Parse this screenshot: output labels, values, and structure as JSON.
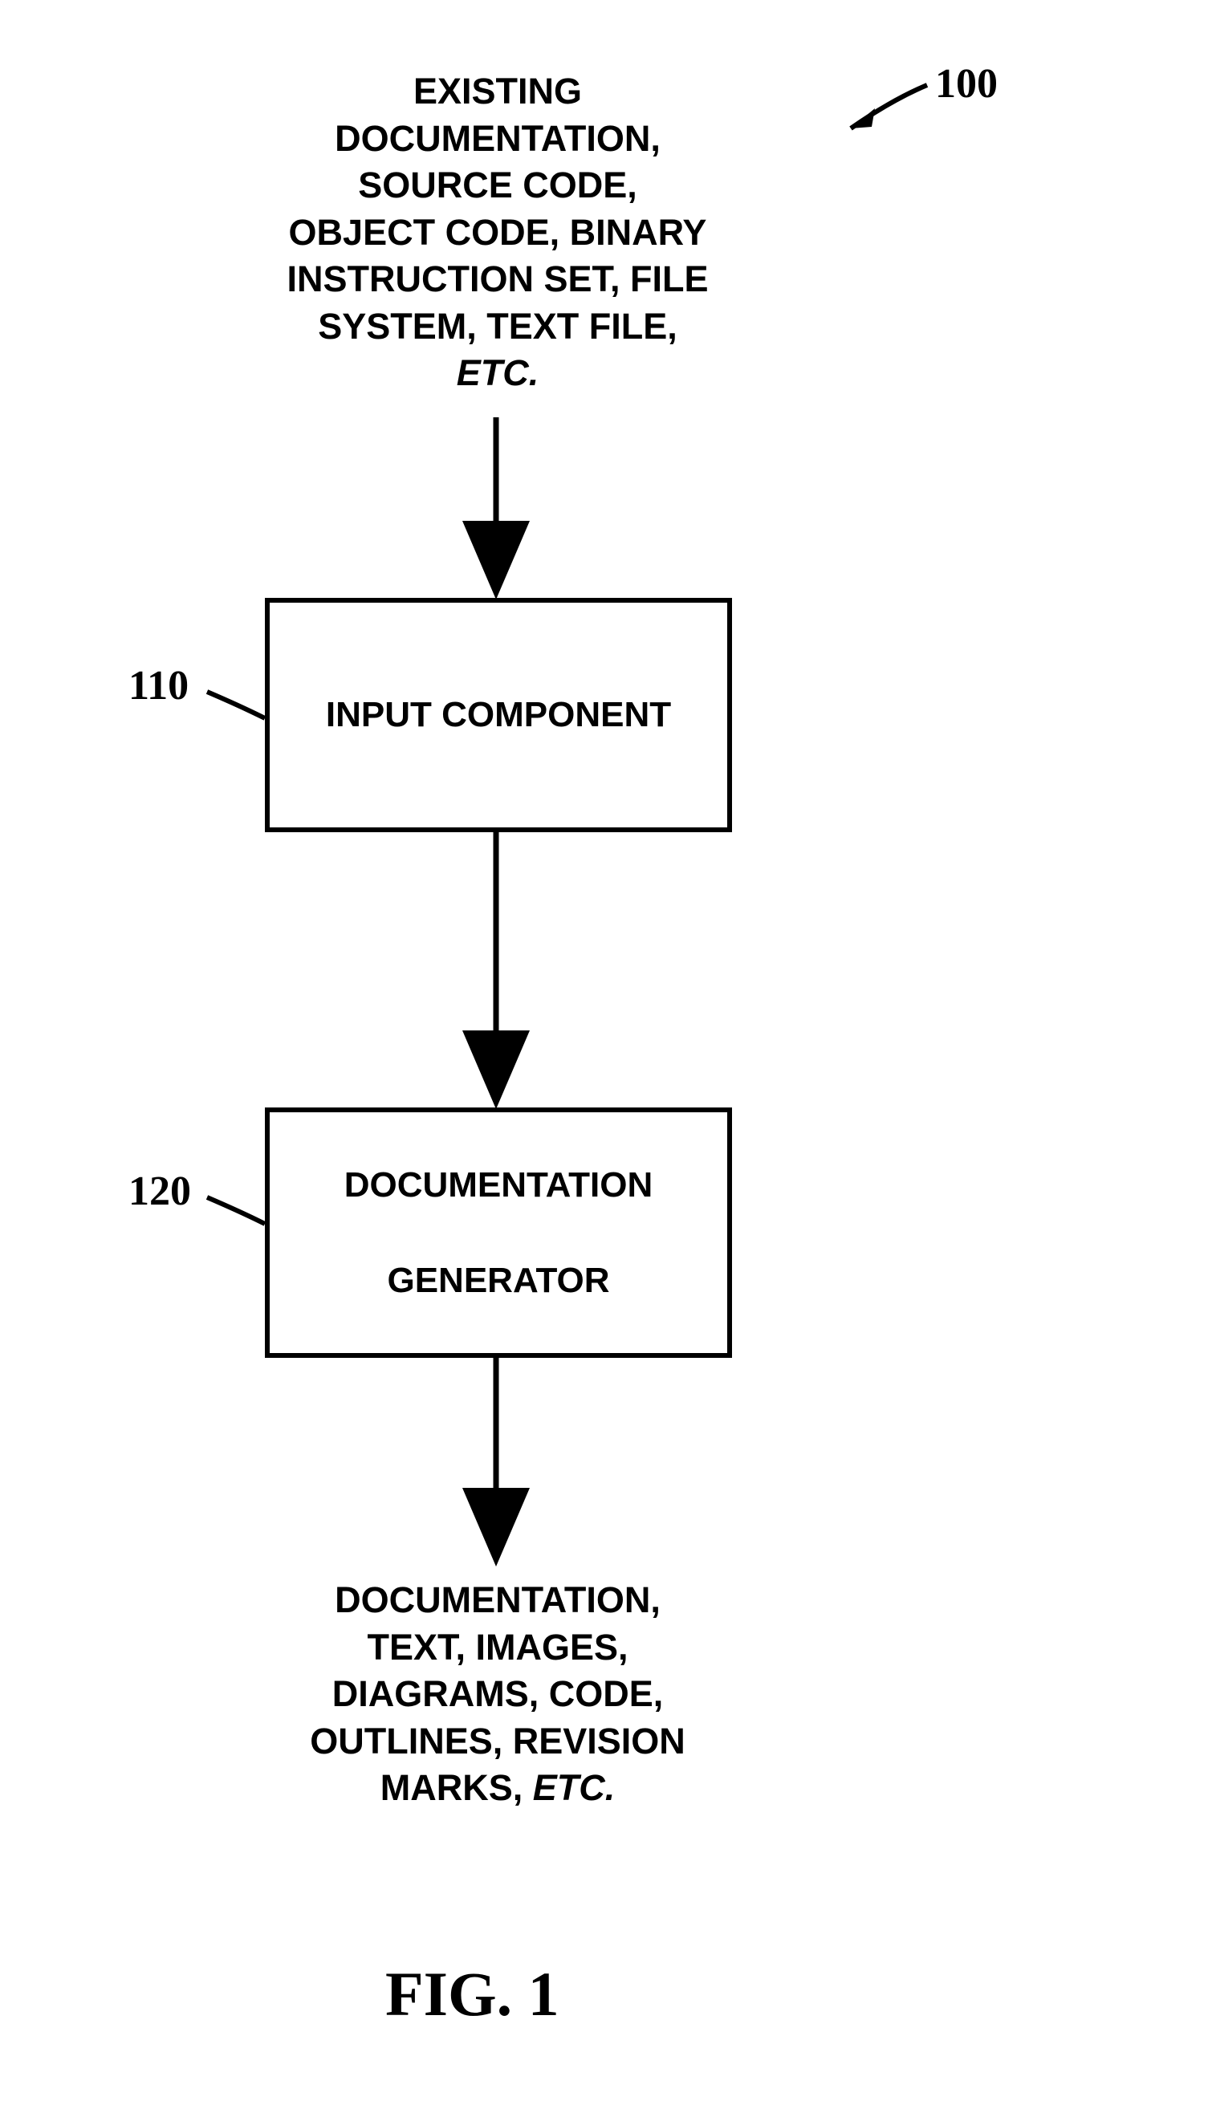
{
  "refs": {
    "overall": "100",
    "box1": "110",
    "box2": "120"
  },
  "input_text": {
    "l1": "EXISTING",
    "l2": "DOCUMENTATION,",
    "l3": "SOURCE CODE,",
    "l4": "OBJECT CODE, BINARY",
    "l5": "INSTRUCTION SET, FILE",
    "l6": "SYSTEM, TEXT FILE,",
    "l7": "ETC."
  },
  "box1_label": "INPUT COMPONENT",
  "box2_label_l1": "DOCUMENTATION",
  "box2_label_l2": "GENERATOR",
  "output_text": {
    "l1": "DOCUMENTATION,",
    "l2": "TEXT, IMAGES,",
    "l3": "DIAGRAMS, CODE,",
    "l4": "OUTLINES, REVISION",
    "l5": "MARKS, ",
    "l5_italic": "ETC."
  },
  "figure_label": "FIG. 1"
}
